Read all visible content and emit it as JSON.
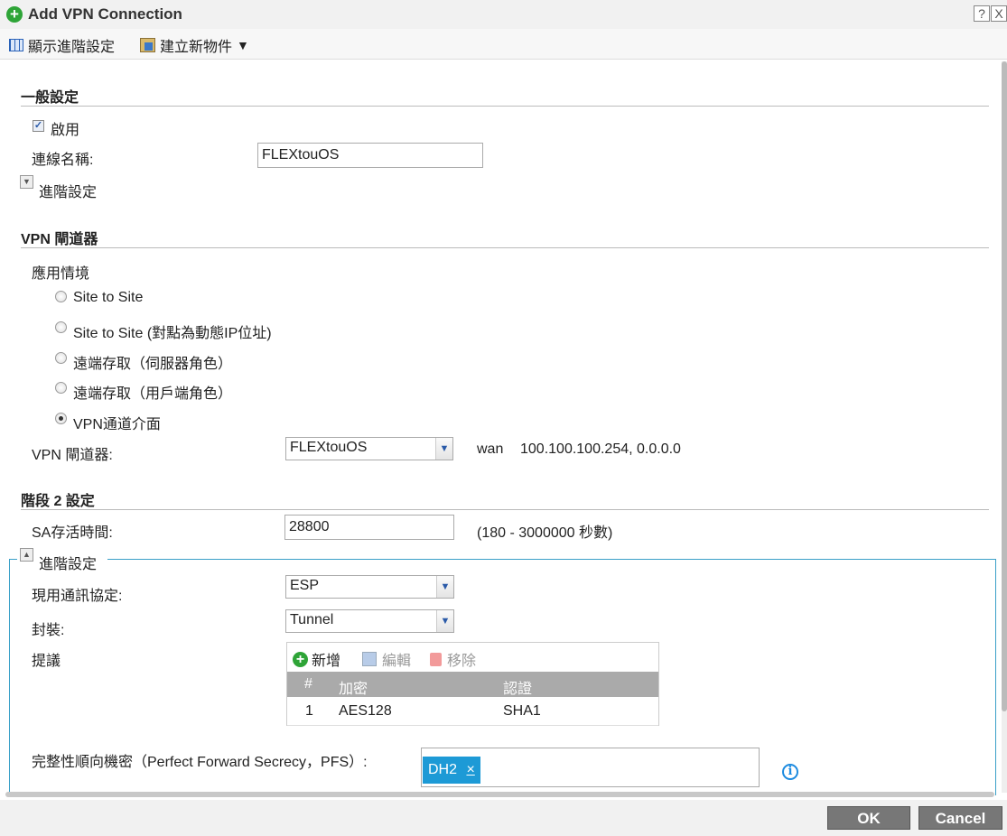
{
  "window": {
    "title": "Add VPN Connection",
    "help": "?",
    "close": "X"
  },
  "toolbar": {
    "show_advanced": "顯示進階設定",
    "create_object": "建立新物件",
    "dropdown_arrow": "▼"
  },
  "general": {
    "title": "一般設定",
    "enable_label": "啟用",
    "enable_checked": true,
    "conn_name_label": "連線名稱:",
    "conn_name_value": "FLEXtouOS",
    "advanced_label": "進階設定"
  },
  "vpn_gateway": {
    "title": "VPN 閘道器",
    "scenario_label": "應用情境",
    "scenarios": [
      {
        "label": "Site to Site",
        "selected": false
      },
      {
        "label": "Site to Site (對點為動態IP位址)",
        "selected": false
      },
      {
        "label": "遠端存取（伺服器角色）",
        "selected": false
      },
      {
        "label": "遠端存取（用戶端角色）",
        "selected": false
      },
      {
        "label": "VPN通道介面",
        "selected": true
      }
    ],
    "gateway_label": "VPN 閘道器:",
    "gateway_value": "FLEXtouOS",
    "gateway_info_iface": "wan",
    "gateway_info_addr": "100.100.100.254, 0.0.0.0"
  },
  "phase2": {
    "title": "階段 2 設定",
    "sa_label": "SA存活時間:",
    "sa_value": "28800",
    "sa_range": "(180 - 3000000 秒數)",
    "advanced_label": "進階設定",
    "protocol_label": "現用通訊協定:",
    "protocol_value": "ESP",
    "encap_label": "封裝:",
    "encap_value": "Tunnel",
    "proposal_label": "提議",
    "proposal_toolbar": {
      "add": "新增",
      "edit": "編輯",
      "remove": "移除"
    },
    "proposal_columns": [
      "#",
      "加密",
      "認證"
    ],
    "proposal_rows": [
      {
        "num": "1",
        "enc": "AES128",
        "auth": "SHA1"
      }
    ],
    "pfs_label": "完整性順向機密（Perfect Forward Secrecy，PFS）:",
    "pfs_tag": "DH2",
    "pfs_tag_remove": "×"
  },
  "footer": {
    "ok": "OK",
    "cancel": "Cancel"
  }
}
